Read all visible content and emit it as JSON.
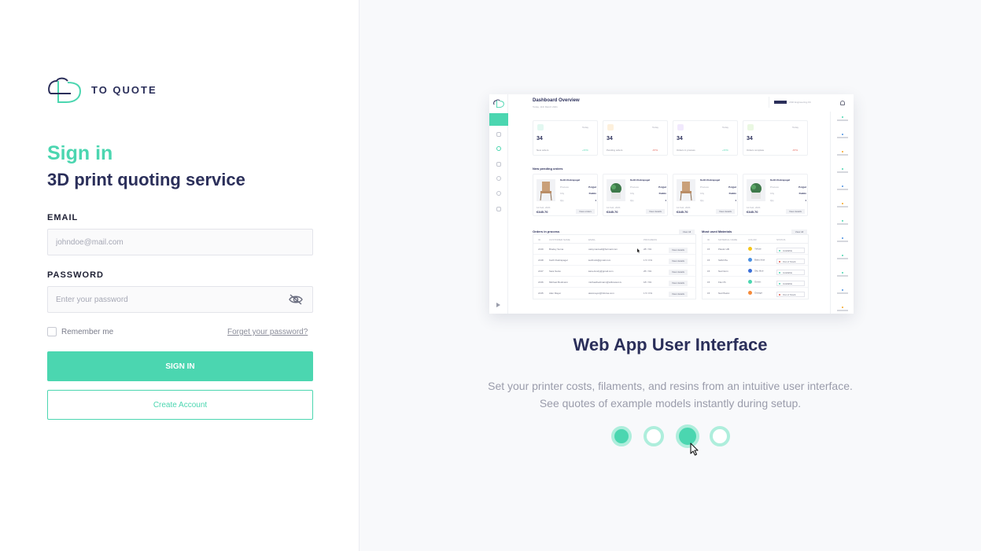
{
  "brand": {
    "name": "TO QUOTE"
  },
  "signin": {
    "title": "Sign in",
    "subtitle": "3D print quoting service",
    "email_label": "EMAIL",
    "email_placeholder": "johndoe@mail.com",
    "password_label": "PASSWORD",
    "password_placeholder": "Enter your password",
    "remember_label": "Remember me",
    "forgot_label": "Forget your password?",
    "signin_button": "SIGN IN",
    "create_button": "Create Account"
  },
  "carousel": {
    "title": "Web App User Interface",
    "description_line1": "Set your printer costs, filaments, and resins from an intuitive user interface.",
    "description_line2": "See quotes of example models instantly during setup.",
    "total_slides": 4,
    "active_slide": 3
  },
  "dashboard": {
    "title": "Dashboard Overview",
    "date": "Today, 11th March 2021",
    "company": "ASD Engineering AS",
    "stats": [
      {
        "value": "34",
        "label": "New orders",
        "period": "Today",
        "change": "+67%",
        "color": "#4bd6b0"
      },
      {
        "value": "34",
        "label": "Pending orders",
        "period": "Today",
        "change": "-67%",
        "color": "#f6a623"
      },
      {
        "value": "34",
        "label": "Orders in process",
        "period": "Today",
        "change": "+67%",
        "color": "#b58cf0"
      },
      {
        "value": "34",
        "label": "Orders complete",
        "period": "Today",
        "change": "-67%",
        "color": "#8bd96c"
      }
    ],
    "pending_title": "New pending orders",
    "orders": [
      {
        "name": "Keith Rodzapagel",
        "process_label": "Process",
        "process": "Polyjet",
        "city_label": "City",
        "city": "Dublin",
        "qty_label": "Qty",
        "qty": "1",
        "date": "12 Feb, 2021",
        "price": "€345.70",
        "button": "View orders"
      },
      {
        "name": "Keith Rodzapagel",
        "process_label": "Process",
        "process": "Polyjet",
        "city_label": "City",
        "city": "Dublin",
        "qty_label": "Qty",
        "qty": "1",
        "date": "12 Feb, 2021",
        "price": "€345.70",
        "button": "View details"
      },
      {
        "name": "Keith Rodzapagel",
        "process_label": "Process",
        "process": "Polyjet",
        "city_label": "City",
        "city": "Dublin",
        "qty_label": "Qty",
        "qty": "1",
        "date": "12 Feb, 2021",
        "price": "€345.70",
        "button": "View details"
      },
      {
        "name": "Keith Rodzapagel",
        "process_label": "Process",
        "process": "Polyjet",
        "city_label": "City",
        "city": "Dublin",
        "qty_label": "Qty",
        "qty": "1",
        "date": "12 Feb, 2021",
        "price": "€345.70",
        "button": "View details"
      }
    ],
    "in_process": {
      "title": "Orders in process",
      "view_all": "View All",
      "headers": [
        "ID",
        "CUSTOMER NAME",
        "EMAIL",
        "PROGRESS"
      ],
      "rows": [
        [
          "2139",
          "Bradey Soma",
          "catsymaxwell@hotmail.com",
          "28 / h%",
          "View details"
        ],
        [
          "2138",
          "Keith Rodzapagel",
          "keithvick@gmail.com",
          "1 5 / h%",
          "View details"
        ],
        [
          "2137",
          "Sara Santo",
          "kara.dundy@gmail.com",
          "25 / h%",
          "View details"
        ],
        [
          "2136",
          "Michael Bodmann",
          "michaelbedmann@willowtest.ru",
          "18 / h%",
          "View details"
        ],
        [
          "2135",
          "Alan Mayer",
          "alanmayer@Inforsa.com",
          "1 5 / h%",
          "View details"
        ]
      ]
    },
    "materials": {
      "title": "Most used Materials",
      "view_all": "View All",
      "headers": [
        "ID",
        "MATERIAL NAME",
        "COLOR",
        "STATUS"
      ],
      "rows": [
        {
          "id": "15",
          "name": "Plastic HB",
          "color": "Yellow",
          "hex": "#f5c518",
          "status": "Available",
          "status_color": "#4bd6b0"
        },
        {
          "id": "15",
          "name": "SHM Pla",
          "color": "Baby blue",
          "hex": "#4a90e2",
          "status": "Out of Stock",
          "status_color": "#e2574c"
        },
        {
          "id": "15",
          "name": "Nat Norm",
          "color": "Sky blue",
          "hex": "#3b6fd8",
          "status": "Available",
          "status_color": "#4bd6b0"
        },
        {
          "id": "15",
          "name": "Flex PL",
          "color": "Green",
          "hex": "#4bd6b0",
          "status": "Available",
          "status_color": "#4bd6b0"
        },
        {
          "id": "15",
          "name": "Nat Plastic",
          "color": "Orange",
          "hex": "#f58a3a",
          "status": "Out of Stock",
          "status_color": "#e2574c"
        }
      ]
    }
  },
  "colors": {
    "accent": "#4bd6b0",
    "navy": "#2b2f5a",
    "muted": "#9a9cab"
  }
}
